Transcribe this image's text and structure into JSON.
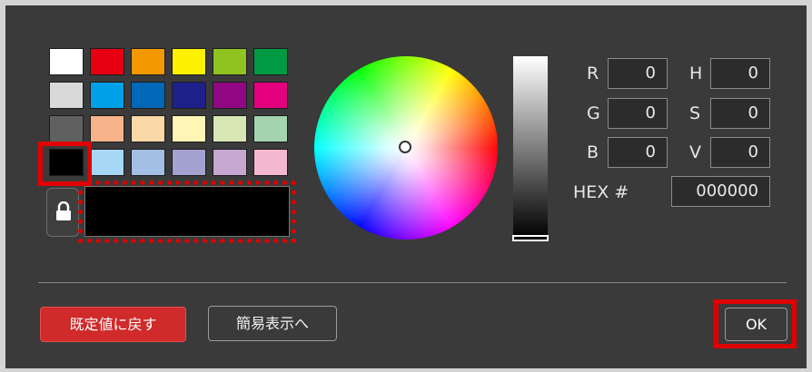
{
  "palette": {
    "rows": [
      [
        "#ffffff",
        "#e60012",
        "#f39800",
        "#fff100",
        "#8fc31f",
        "#009944"
      ],
      [
        "#d9d9d9",
        "#00a0e9",
        "#0068b7",
        "#1d2088",
        "#920783",
        "#e4007f"
      ],
      [
        "#606060",
        "#f6b38a",
        "#fad8a8",
        "#fff5b4",
        "#d8e6b6",
        "#a4d4ae"
      ],
      [
        "#000000",
        "#a6d7f5",
        "#a3bfe3",
        "#a3a1cf",
        "#c6a7d0",
        "#f4b7d0"
      ]
    ],
    "selected": "#000000"
  },
  "current_color": "#000000",
  "icons": {
    "lock": "lock-icon"
  },
  "fields": {
    "r": {
      "label": "R",
      "value": "0"
    },
    "g": {
      "label": "G",
      "value": "0"
    },
    "b": {
      "label": "B",
      "value": "0"
    },
    "h": {
      "label": "H",
      "value": "0"
    },
    "s": {
      "label": "S",
      "value": "0"
    },
    "v": {
      "label": "V",
      "value": "0"
    },
    "hex": {
      "label": "HEX #",
      "value": "000000"
    }
  },
  "buttons": {
    "reset": "既定値に戻す",
    "simple": "簡易表示へ",
    "ok": "OK"
  },
  "colors": {
    "accent": "#d02a2a",
    "highlight": "#e00000",
    "background": "#3a3a3a"
  }
}
